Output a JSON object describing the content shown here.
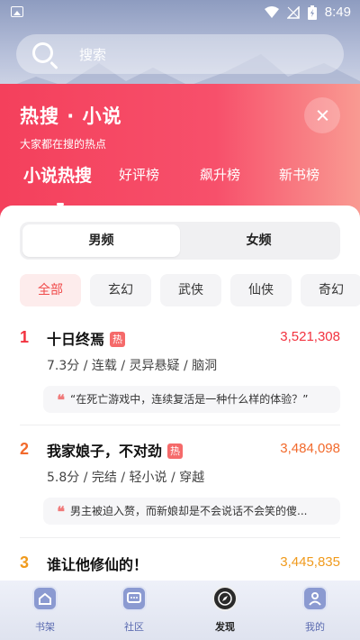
{
  "status_bar": {
    "time": "8:49"
  },
  "search": {
    "placeholder": "搜索"
  },
  "header": {
    "title": "热搜 · 小说",
    "subtitle": "大家都在搜的热点",
    "tabs": [
      {
        "label": "小说热搜"
      },
      {
        "label": "好评榜"
      },
      {
        "label": "飙升榜"
      },
      {
        "label": "新书榜"
      }
    ]
  },
  "gender_tabs": [
    {
      "label": "男频"
    },
    {
      "label": "女频"
    }
  ],
  "genres": [
    {
      "label": "全部"
    },
    {
      "label": "玄幻"
    },
    {
      "label": "武侠"
    },
    {
      "label": "仙侠"
    },
    {
      "label": "奇幻"
    }
  ],
  "hot_badge": "热",
  "books": [
    {
      "rank": "1",
      "title": "十日终焉",
      "heat": "3,521,308",
      "meta": "7.3分 / 连载 / 灵异悬疑 / 脑洞",
      "quote": "“在死亡游戏中，连续复活是一种什么样的体验？”"
    },
    {
      "rank": "2",
      "title": "我家娘子，不对劲",
      "heat": "3,484,098",
      "meta": "5.8分 / 完结 / 轻小说 / 穿越",
      "quote": "男主被迫入赘，而新娘却是不会说话不会笑的傻..."
    },
    {
      "rank": "3",
      "title": "谁让他修仙的！",
      "heat": "3,445,835"
    }
  ],
  "colors": {
    "rank1": "#f2323f",
    "rank2": "#f26a2c",
    "rank3": "#f09a1c",
    "accent": "#f4405c"
  },
  "nav": [
    {
      "label": "书架",
      "icon": "home-icon"
    },
    {
      "label": "社区",
      "icon": "chat-icon"
    },
    {
      "label": "发现",
      "icon": "compass-icon"
    },
    {
      "label": "我的",
      "icon": "user-icon"
    }
  ]
}
